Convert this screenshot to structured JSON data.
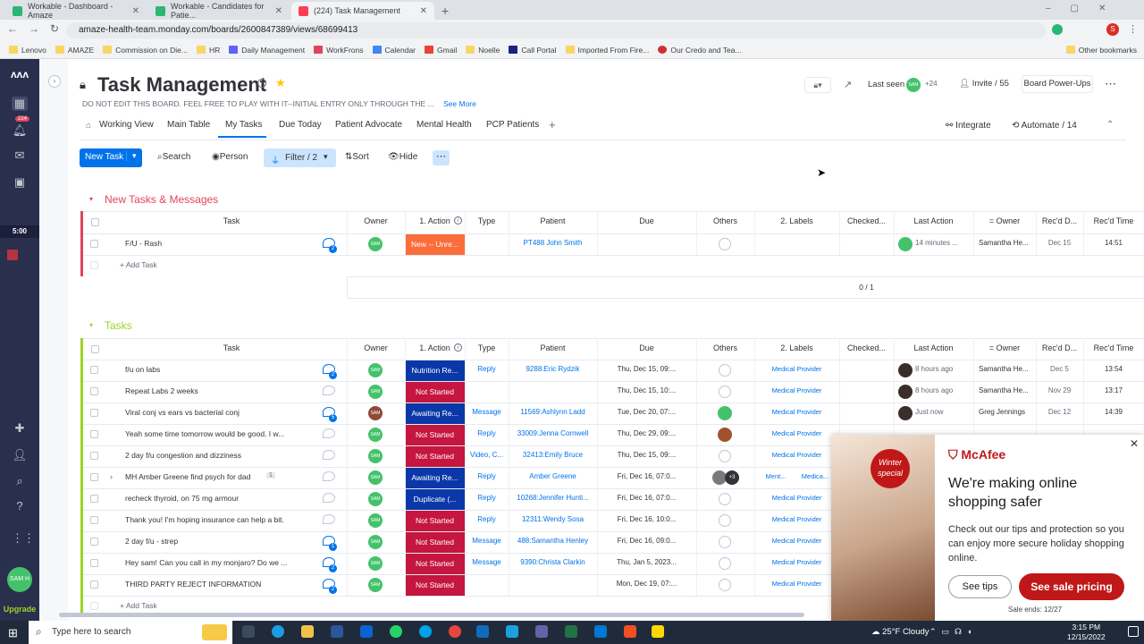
{
  "browser": {
    "tabs": [
      {
        "title": "Workable - Dashboard - Amaze"
      },
      {
        "title": "Workable - Candidates for Patie..."
      },
      {
        "title": "(224) Task Management"
      }
    ],
    "url": "amaze-health-team.monday.com/boards/2600847389/views/68699413",
    "bookmarks": [
      "Lenovo",
      "AMAZE",
      "Commission on Die...",
      "HR",
      "Daily Management",
      "WorkFrons",
      "Calendar",
      "Gmail",
      "Noelle",
      "Call Portal",
      "Imported From Fire...",
      "Our Credo and Tea..."
    ],
    "other_bookmarks": "Other bookmarks"
  },
  "sidebar": {
    "notifications": "224",
    "timer": "5:00",
    "upgrade": "Upgrade",
    "avatar_text": "SAM H"
  },
  "board": {
    "title": "Task Management",
    "description": "DO NOT EDIT THIS BOARD. FEEL FREE TO PLAY WITH IT--INITIAL ENTRY ONLY THROUGH THE ...",
    "see_more": "See More",
    "last_seen": "Last seen",
    "last_seen_count": "+24",
    "invite": "Invite / 55",
    "power_ups": "Board Power-Ups",
    "views": [
      "Working View",
      "Main Table",
      "My Tasks",
      "Due Today",
      "Patient Advocate",
      "Mental Health",
      "PCP Patients"
    ],
    "integrate": "Integrate",
    "automate": "Automate / 14",
    "toolbar": {
      "new_task": "New Task",
      "search": "Search",
      "person": "Person",
      "filter": "Filter / 2",
      "sort": "Sort",
      "hide": "Hide"
    }
  },
  "columns": [
    "Task",
    "Owner",
    "1. Action",
    "Type",
    "Patient",
    "Due",
    "Others",
    "2. Labels",
    "Checked...",
    "Last Action",
    "= Owner",
    "Rec'd D...",
    "Rec'd Time"
  ],
  "group1": {
    "title": "New Tasks & Messages",
    "color": "#e2445c",
    "rows": [
      {
        "task": "F/U - Rash",
        "updates": "2",
        "action": "New -- Unre...",
        "action_color": "#fb6d3b",
        "type": "",
        "patient": "PT488 John Smith",
        "due": "",
        "labels": "",
        "last_action": "14 minutes ...",
        "owner2": "Samantha He...",
        "recd_date": "Dec 15",
        "recd_time": "14:51"
      }
    ],
    "add": "+ Add Task",
    "summary": "0 / 1"
  },
  "group2": {
    "title": "Tasks",
    "color": "#9cd326",
    "rows": [
      {
        "task": "f/u on labs",
        "updates": "2",
        "action": "Nutrition Re...",
        "action_color": "#0b38a8",
        "type": "Reply",
        "patient": "9288:Eric Rydzik",
        "due": "Thu, Dec 15, 09:...",
        "labels": "Medical Provider",
        "last_action": "8 hours ago",
        "owner2": "Samantha He...",
        "recd_date": "Dec 5",
        "recd_time": "13:54"
      },
      {
        "task": "Repeat Labs 2 weeks",
        "updates": "",
        "action": "Not Started",
        "action_color": "#c4163f",
        "type": "",
        "patient": "",
        "due": "Thu, Dec 15, 10:...",
        "labels": "Medical Provider",
        "last_action": "8 hours ago",
        "owner2": "Samantha He...",
        "recd_date": "Nov 29",
        "recd_time": "13:17"
      },
      {
        "task": "Viral conj vs ears vs bacterial conj",
        "updates": "5",
        "action": "Awaiting Re...",
        "action_color": "#0b38a8",
        "type": "Message",
        "patient": "11569:Ashlynn Ladd",
        "due": "Tue, Dec 20, 07:...",
        "labels": "Medical Provider",
        "last_action": "Just now",
        "owner2": "Greg Jennings",
        "recd_date": "Dec 12",
        "recd_time": "14:39"
      },
      {
        "task": "Yeah some time tomorrow would be good. I w...",
        "updates": "",
        "action": "Not Started",
        "action_color": "#c4163f",
        "type": "Reply",
        "patient": "33009:Jenna Cornwell",
        "due": "Thu, Dec 29, 09:...",
        "labels": "Medical Provider",
        "last_action": "",
        "owner2": "",
        "recd_date": "",
        "recd_time": ""
      },
      {
        "task": "2 day f/u congestion and dizziness",
        "updates": "",
        "action": "Not Started",
        "action_color": "#c4163f",
        "type": "Video, C...",
        "patient": "32413:Emily Bruce",
        "due": "Thu, Dec 15, 09:...",
        "labels": "Medical Provider",
        "last_action": "",
        "owner2": "",
        "recd_date": "",
        "recd_time": ""
      },
      {
        "task": "MH Amber Greene find psych for dad",
        "updates": "",
        "subitems": "1",
        "action": "Awaiting Re...",
        "action_color": "#0b38a8",
        "type": "Reply",
        "patient": "Amber Greene",
        "due": "Fri, Dec 16, 07:0...",
        "labels": "Ment...",
        "labels2": "Medica...",
        "last_action": "",
        "owner2": "",
        "recd_date": "",
        "recd_time": ""
      },
      {
        "task": "recheck thyroid, on 75 mg armour",
        "updates": "",
        "action": "Duplicate (...",
        "action_color": "#0b38a8",
        "type": "Reply",
        "patient": "10268:Jennifer Hunti...",
        "due": "Fri, Dec 16, 07:0...",
        "labels": "Medical Provider",
        "last_action": "",
        "owner2": "",
        "recd_date": "",
        "recd_time": ""
      },
      {
        "task": "Thank you! I'm hoping insurance can help a bit.",
        "updates": "",
        "action": "Not Started",
        "action_color": "#c4163f",
        "type": "Reply",
        "patient": "12311:Wendy Sosa",
        "due": "Fri, Dec 16, 10:0...",
        "labels": "Medical Provider",
        "last_action": "",
        "owner2": "",
        "recd_date": "",
        "recd_time": ""
      },
      {
        "task": "2 day f/u - strep",
        "updates": "1",
        "action": "Not Started",
        "action_color": "#c4163f",
        "type": "Message",
        "patient": "488:Samantha Henley",
        "due": "Fri, Dec 16, 09:0...",
        "labels": "Medical Provider",
        "last_action": "",
        "owner2": "",
        "recd_date": "",
        "recd_time": ""
      },
      {
        "task": "Hey sam! Can you call in my monjaro? Do we ...",
        "updates": "2",
        "action": "Not Started",
        "action_color": "#c4163f",
        "type": "Message",
        "patient": "9390:Christa Clarkin",
        "due": "Thu, Jan 5, 2023...",
        "labels": "Medical Provider",
        "last_action": "",
        "owner2": "",
        "recd_date": "",
        "recd_time": ""
      },
      {
        "task": "THIRD PARTY REJECT INFORMATION",
        "updates": "2",
        "action": "Not Started",
        "action_color": "#c4163f",
        "type": "",
        "patient": "",
        "due": "Mon, Dec 19, 07:...",
        "labels": "Medical Provider",
        "last_action": "",
        "owner2": "",
        "recd_date": "",
        "recd_time": ""
      }
    ],
    "add": "+ Add Task",
    "others_more": "+3"
  },
  "ad": {
    "brand": "McAfee",
    "badge": "Winter special",
    "headline": "We're making online shopping safer",
    "body": "Check out our tips and protection so you can enjoy more secure holiday shopping online.",
    "tips": "See tips",
    "pricing": "See sale pricing",
    "ends": "Sale ends: 12/27"
  },
  "taskbar": {
    "search": "Type here to search",
    "weather": "25°F  Cloudy",
    "time": "3:15 PM",
    "date": "12/15/2022"
  }
}
